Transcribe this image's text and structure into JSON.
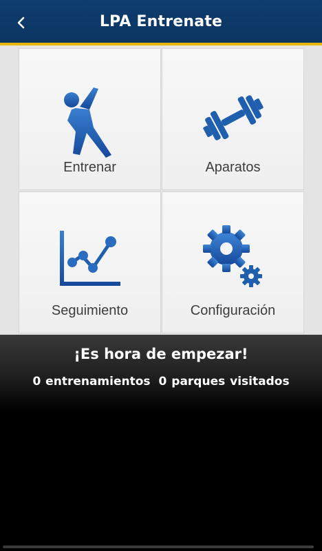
{
  "header": {
    "title": "LPA Entrenate",
    "back_icon": "chevron-left-icon"
  },
  "menu": {
    "items": [
      {
        "label": "Entrenar",
        "icon": "exercise-person-icon"
      },
      {
        "label": "Aparatos",
        "icon": "dumbbell-icon"
      },
      {
        "label": "Seguimiento",
        "icon": "line-chart-icon"
      },
      {
        "label": "Configuración",
        "icon": "gears-icon"
      }
    ]
  },
  "status": {
    "headline": "¡Es hora de empezar!",
    "workouts": "0 entrenamientos",
    "parks": "0 parques visitados"
  },
  "colors": {
    "header_bg": "#0f3d6e",
    "header_accent": "#e9b60d",
    "icon_blue": "#1f5fae"
  }
}
